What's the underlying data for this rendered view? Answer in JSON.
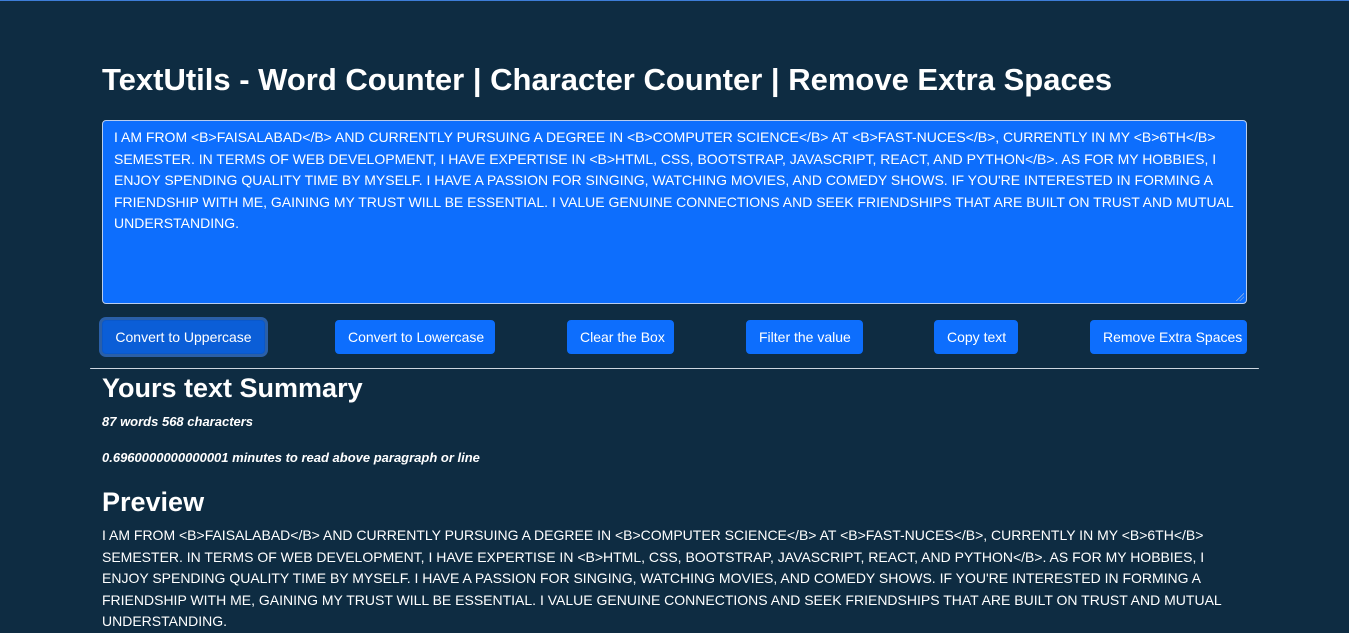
{
  "header": {
    "title": "TextUtils - Word Counter | Character Counter | Remove Extra Spaces"
  },
  "textarea": {
    "value": "I AM FROM <B>FAISALABAD</B> AND CURRENTLY PURSUING A DEGREE IN <B>COMPUTER SCIENCE</B> AT <B>FAST-NUCES</B>, CURRENTLY IN MY <B>6TH</B> SEMESTER. IN TERMS OF WEB DEVELOPMENT, I HAVE EXPERTISE IN <B>HTML, CSS, BOOTSTRAP, JAVASCRIPT, REACT, AND PYTHON</B>. AS FOR MY HOBBIES, I ENJOY SPENDING QUALITY TIME BY MYSELF. I HAVE A PASSION FOR SINGING, WATCHING MOVIES, AND COMEDY SHOWS. IF YOU'RE INTERESTED IN FORMING A FRIENDSHIP WITH ME, GAINING MY TRUST WILL BE ESSENTIAL. I VALUE GENUINE CONNECTIONS AND SEEK FRIENDSHIPS THAT ARE BUILT ON TRUST AND MUTUAL UNDERSTANDING."
  },
  "toolbar": {
    "uppercase_label": "Convert to Uppercase",
    "lowercase_label": "Convert to Lowercase",
    "clear_label": "Clear the Box",
    "filter_label": "Filter the value",
    "copy_label": "Copy text",
    "remove_spaces_label": "Remove Extra Spaces"
  },
  "summary": {
    "heading": "Yours text Summary",
    "counts": "87 words 568 characters",
    "read_time": "0.6960000000000001 minutes to read above paragraph or line"
  },
  "preview": {
    "heading": "Preview",
    "text": "I AM FROM <B>FAISALABAD</B> AND CURRENTLY PURSUING A DEGREE IN <B>COMPUTER SCIENCE</B> AT <B>FAST-NUCES</B>, CURRENTLY IN MY <B>6TH</B> SEMESTER. IN TERMS OF WEB DEVELOPMENT, I HAVE EXPERTISE IN <B>HTML, CSS, BOOTSTRAP, JAVASCRIPT, REACT, AND PYTHON</B>. AS FOR MY HOBBIES, I ENJOY SPENDING QUALITY TIME BY MYSELF. I HAVE A PASSION FOR SINGING, WATCHING MOVIES, AND COMEDY SHOWS. IF YOU'RE INTERESTED IN FORMING A FRIENDSHIP WITH ME, GAINING MY TRUST WILL BE ESSENTIAL. I VALUE GENUINE CONNECTIONS AND SEEK FRIENDSHIPS THAT ARE BUILT ON TRUST AND MUTUAL UNDERSTANDING."
  },
  "colors": {
    "background": "#0e2c42",
    "primary": "#0d6efd",
    "text": "#ffffff"
  }
}
